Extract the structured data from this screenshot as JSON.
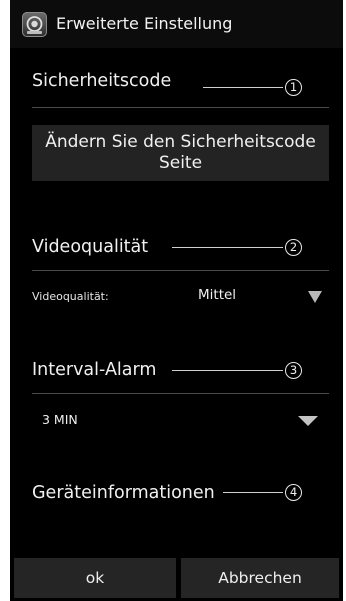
{
  "dialog": {
    "title": "Erweiterte Einstellung",
    "icon": "app-logo-icon"
  },
  "sections": [
    {
      "title": "Sicherheitscode",
      "marker": "1"
    },
    {
      "title": "Videoqualität",
      "marker": "2"
    },
    {
      "title": "Interval-Alarm",
      "marker": "3"
    },
    {
      "title": "Geräteinformationen",
      "marker": "4"
    }
  ],
  "security": {
    "button_line1": "Ändern Sie den Sicherheitscode",
    "button_line2": "Seite"
  },
  "video_quality": {
    "label": "Videoqualität:",
    "selected": "Mittel"
  },
  "interval_alarm": {
    "selected": "3 MIN"
  },
  "buttons": {
    "ok": "ok",
    "cancel": "Abbrechen"
  },
  "colors": {
    "background": "#000000",
    "button_bg": "#232323",
    "text": "#f0f0f0",
    "divider": "#4a4a4a"
  }
}
